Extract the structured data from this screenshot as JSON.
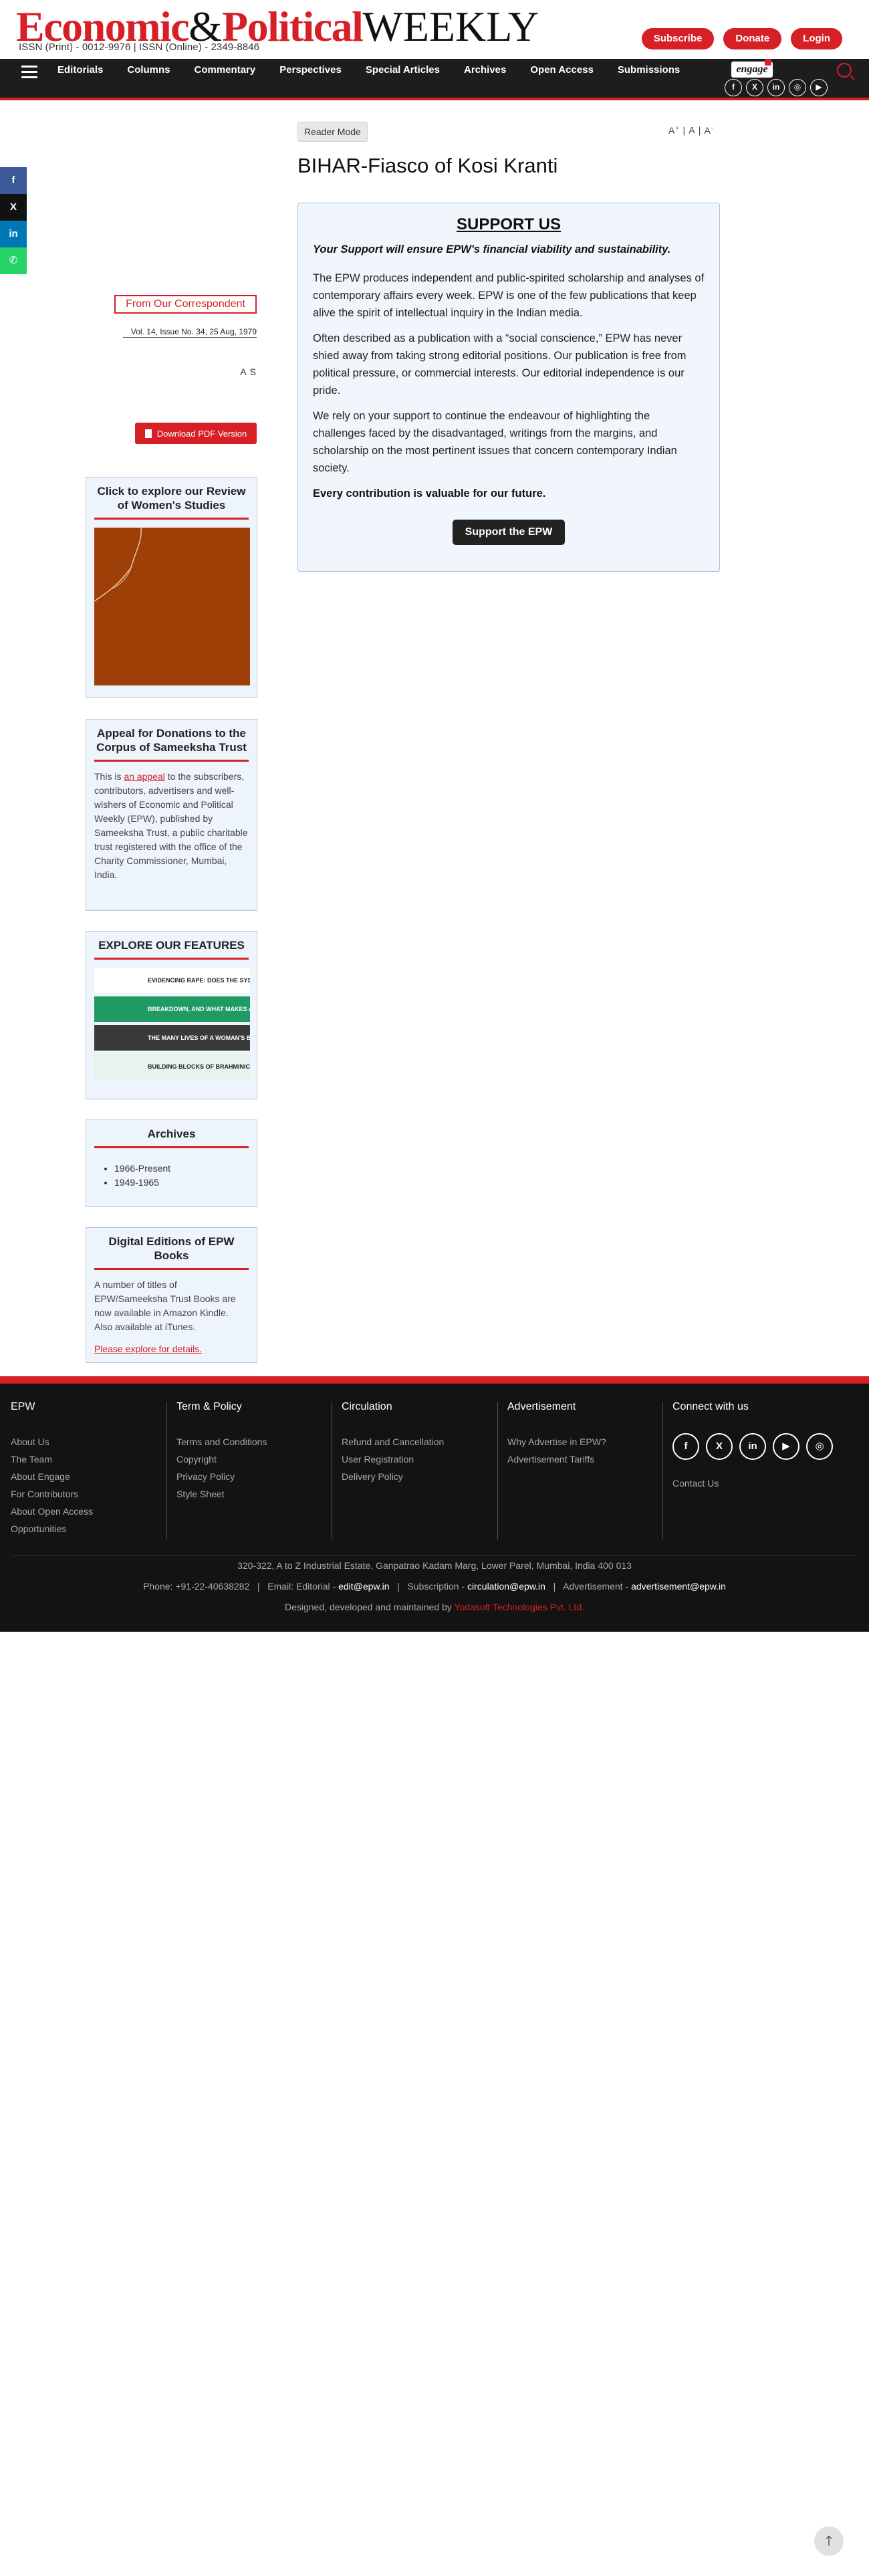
{
  "header": {
    "logo_part1": "Economic",
    "logo_amp": "&",
    "logo_part2": "Political",
    "logo_part3": "WEEKLY",
    "issn": "ISSN (Print) - 0012-9976 | ISSN (Online) - 2349-8846",
    "subscribe": "Subscribe",
    "donate": "Donate",
    "login": "Login"
  },
  "nav": {
    "items": [
      "Editorials",
      "Columns",
      "Commentary",
      "Perspectives",
      "Special Articles",
      "Archives",
      "Open Access",
      "Submissions"
    ],
    "engage": "engage",
    "socials": [
      "f",
      "X",
      "in",
      "◎",
      "▶"
    ]
  },
  "share": [
    {
      "icon": "f",
      "color": "#3b5998"
    },
    {
      "icon": "X",
      "color": "#111111"
    },
    {
      "icon": "in",
      "color": "#0077b5"
    },
    {
      "icon": "✆",
      "color": "#25d366"
    }
  ],
  "article": {
    "reader_mode": "Reader Mode",
    "font_controls": "A | A | A",
    "title": "BIHAR-Fiasco of Kosi Kranti",
    "correspondent": "From Our Correspondent",
    "volume": "Vol. 14, Issue No. 34, 25 Aug, 1979",
    "author": "A S",
    "pdf_button": "Download PDF Version"
  },
  "support": {
    "heading": "SUPPORT US",
    "tagline": "Your Support will ensure EPW's financial viability and sustainability.",
    "p1": "The EPW produces independent and public-spirited scholarship and analyses of contemporary affairs every week. EPW is one of the few publications that keep alive the spirit of intellectual inquiry in the Indian media.",
    "p2": "Often described as a publication with a “social conscience,” EPW has never shied away from taking strong editorial positions. Our publication is free from political pressure, or commercial interests. Our editorial independence is our pride.",
    "p3": "We rely on your support to continue the endeavour of highlighting the challenges faced by the disadvantaged, writings from the margins, and scholarship on the most pertinent issues that concern contemporary Indian society.",
    "future": "Every contribution is valuable for our future.",
    "button": "Support the EPW"
  },
  "sidebar": {
    "review_title": "Click to explore our Review of Women's Studies",
    "appeal_title": "Appeal for Donations to the Corpus of Sameeksha Trust",
    "appeal_pre": "This is ",
    "appeal_link": "an appeal",
    "appeal_post": " to the subscribers, contributors, advertisers and well-wishers of Economic and Political Weekly (EPW), published by Sameeksha Trust, a public charitable trust registered with the office of the Charity Commissioner, Mumbai, India.",
    "features_title": "EXPLORE OUR FEATURES",
    "features": [
      {
        "label": "EVIDENCING RAPE: DOES THE SYSTEM BELIEVE WOMEN?",
        "color": "#ffffff",
        "text": "#222222"
      },
      {
        "label": "BREAKDOWN, AND WHAT MAKES A CITIZEN: A MAHATMA DIALOGUE",
        "color": "#1f9a63",
        "text": "#ffffff"
      },
      {
        "label": "THE MANY LIVES OF A WOMAN'S BODY",
        "color": "#3a3a3a",
        "text": "#ffffff"
      },
      {
        "label": "BUILDING BLOCKS OF BRAHMINICAL PATRIARCHY",
        "color": "#e7f3ec",
        "text": "#222222"
      }
    ],
    "archives_title": "Archives",
    "archives": [
      "1966-Present",
      "1949-1965"
    ],
    "digital_title": "Digital Editions of EPW Books",
    "digital_text": "A number of titles of EPW/Sameeksha Trust Books are now available in Amazon Kindle. Also available at iTunes.",
    "digital_link": "Please explore for details."
  },
  "footer": {
    "epw_title": "EPW",
    "epw_links": [
      "About Us",
      "The Team",
      "About Engage",
      "For Contributors",
      "About Open Access",
      "Opportunities"
    ],
    "terms_title": "Term & Policy",
    "terms_links": [
      "Terms and Conditions",
      "Copyright",
      "Privacy Policy",
      "Style Sheet"
    ],
    "circ_title": "Circulation",
    "circ_links": [
      "Refund and Cancellation",
      "User Registration",
      "Delivery Policy"
    ],
    "adv_title": "Advertisement",
    "adv_links": [
      "Why Advertise in EPW?",
      "Advertisement Tariffs"
    ],
    "connect_title": "Connect with us",
    "connect_icons": [
      "f",
      "X",
      "in",
      "▶",
      "◎"
    ],
    "contact_us": "Contact Us",
    "address": "320-322, A to Z Industrial Estate, Ganpatrao Kadam Marg, Lower Parel, Mumbai, India 400 013",
    "phone_label": "Phone: +91-22-40638282",
    "editorial_label": "Email: Editorial - ",
    "editorial_email": "edit@epw.in",
    "subscription_label": "Subscription - ",
    "subscription_email": "circulation@epw.in",
    "advertisement_label": "Advertisement - ",
    "advertisement_email": "advertisement@epw.in",
    "credit_pre": "Designed, developed and maintained by ",
    "credit_link": "Yodasoft Technologies Pvt. Ltd."
  },
  "to_top": "🡑"
}
